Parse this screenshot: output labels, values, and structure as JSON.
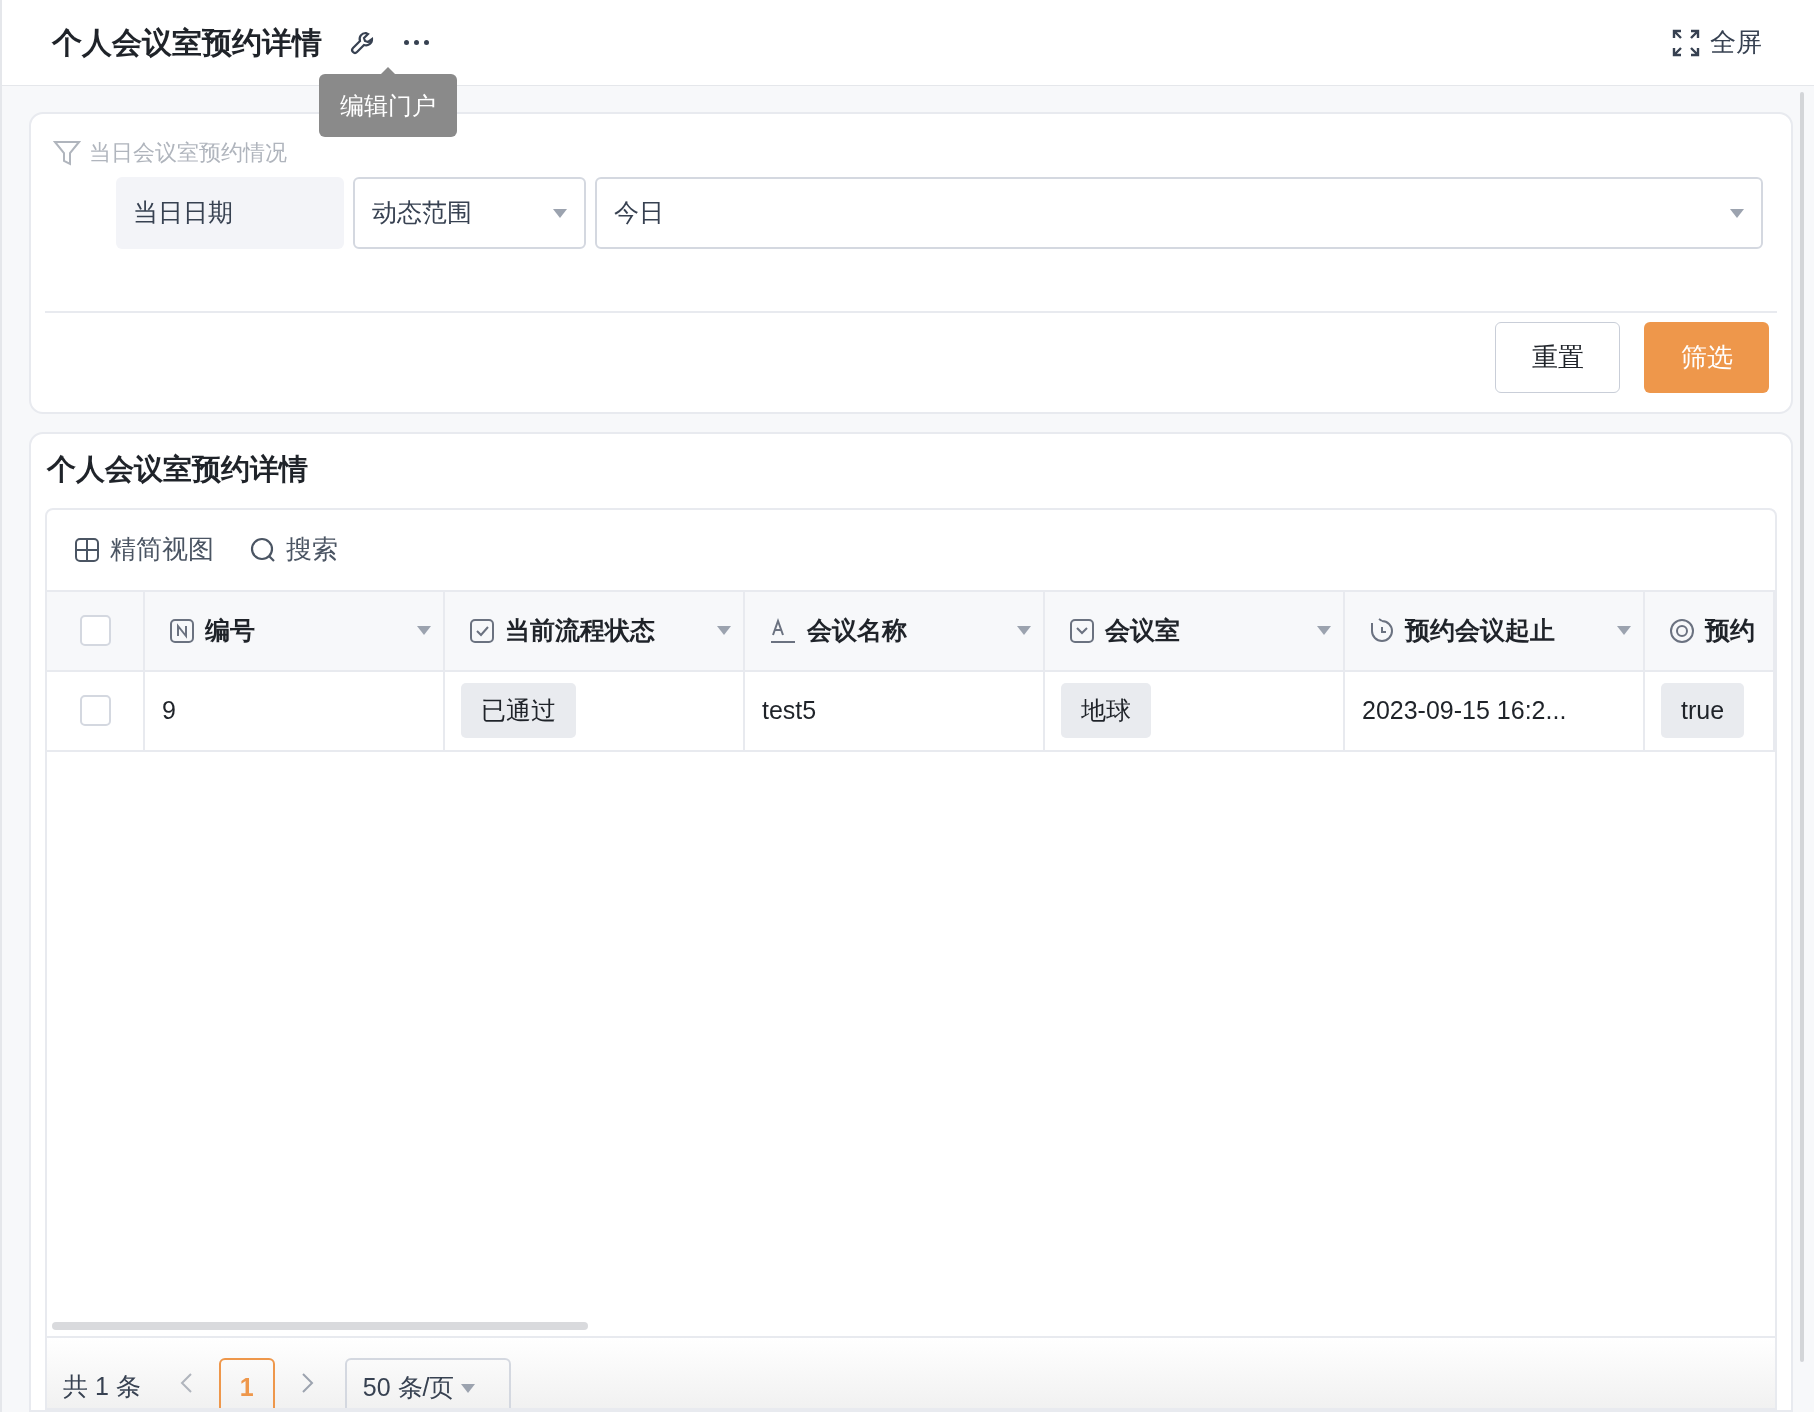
{
  "header": {
    "title": "个人会议室预约详情",
    "tooltip": "编辑门户",
    "fullscreen": "全屏"
  },
  "filter": {
    "title": "当日会议室预约情况",
    "label": "当日日期",
    "mode": "动态范围",
    "value": "今日",
    "buttons": [
      {
        "label": "重置",
        "kind": "default"
      },
      {
        "label": "筛选",
        "kind": "primary"
      }
    ]
  },
  "table_card": {
    "title": "个人会议室预约详情",
    "toolbar": [
      {
        "label": "精简视图",
        "kind": "view"
      },
      {
        "label": "搜索",
        "kind": "search"
      }
    ],
    "header_checkbox": {
      "checked": false
    },
    "columns": [
      {
        "label": "编号",
        "kind": "number"
      },
      {
        "label": "当前流程状态",
        "kind": "checkbox"
      },
      {
        "label": "会议名称",
        "kind": "text"
      },
      {
        "label": "会议室",
        "kind": "dropdown"
      },
      {
        "label": "预约会议起止",
        "kind": "datetime"
      },
      {
        "label": "预约",
        "kind": "radio"
      }
    ],
    "rows": [
      {
        "checked": false,
        "cells": [
          {
            "text": "9",
            "kind": "plain"
          },
          {
            "text": "已通过",
            "kind": "tag"
          },
          {
            "text": "test5",
            "kind": "plain"
          },
          {
            "text": "地球",
            "kind": "tag"
          },
          {
            "text": "2023-09-15 16:2...",
            "kind": "plain"
          },
          {
            "text": "true",
            "kind": "tag"
          }
        ]
      }
    ],
    "pagination": {
      "total": "共 1 条",
      "pages": [
        {
          "label": "1",
          "selected": true
        }
      ],
      "page_size": "50 条/页"
    }
  }
}
